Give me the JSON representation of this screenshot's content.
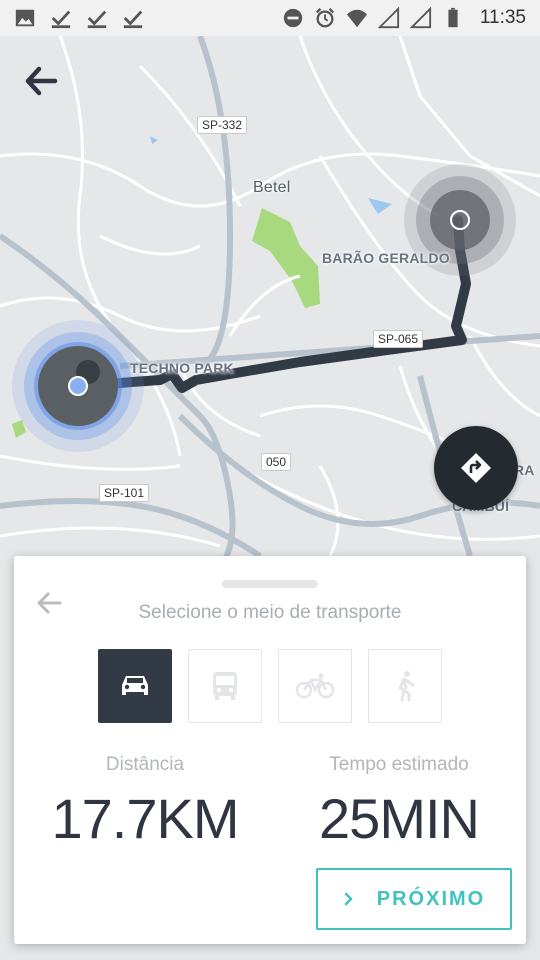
{
  "status_bar": {
    "time": "11:35",
    "left_icons": [
      "image-icon",
      "check-icon",
      "check-icon",
      "check-icon"
    ],
    "right_icons": [
      "dnd-icon",
      "alarm-icon",
      "wifi-icon",
      "signal-icon",
      "signal-icon",
      "battery-icon"
    ]
  },
  "map": {
    "road_labels": [
      "SP-332",
      "SP-065",
      "050",
      "SP-101"
    ],
    "place_labels": [
      "Betel",
      "BARÃO GERALDO",
      "TECHNO PARK",
      "CAMBUÍ",
      "RA"
    ],
    "route_color": "#323a46",
    "origin_color": "#5b8de6",
    "destination_color": "#6e7178"
  },
  "panel": {
    "title": "Selecione o meio de transporte",
    "modes": [
      "car",
      "bus",
      "bike",
      "walk"
    ],
    "selected_mode": "car",
    "distance_label": "Distância",
    "distance_value": "17.7KM",
    "time_label": "Tempo estimado",
    "time_value": "25MIN",
    "next_label": "PRÓXIMO",
    "accent_color": "#3fc2c0"
  }
}
